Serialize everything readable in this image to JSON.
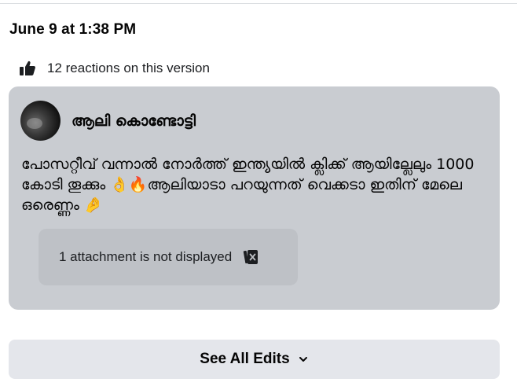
{
  "edit": {
    "timestamp": "June 9 at 1:38 PM",
    "reactions_text": "12 reactions on this version",
    "reaction_icon": "thumbs-up-icon"
  },
  "post": {
    "author_name": "ആലി കൊണ്ടോട്ടി",
    "text": "പോസറ്റീവ് വന്നാൽ നോർത്ത് ഇന്ത്യയിൽ ക്ലിക്ക് ആയില്ലേലും 1000 കോടി തൂക്കും 👌🔥ആലിയാടാ പറയുന്നത് വെക്കടാ ഇതിന് മേലെ ഒരെണ്ണം 🤌",
    "attachment_notice": "1 attachment is not displayed",
    "attachment_icon": "broken-attachment-icon"
  },
  "footer": {
    "see_all_label": "See All Edits",
    "chevron_icon": "chevron-down-icon"
  },
  "colors": {
    "card_bg": "#c9ccd1",
    "attachment_bg": "#bec1c6",
    "button_bg": "#e4e6eb",
    "text_primary": "#050505"
  }
}
